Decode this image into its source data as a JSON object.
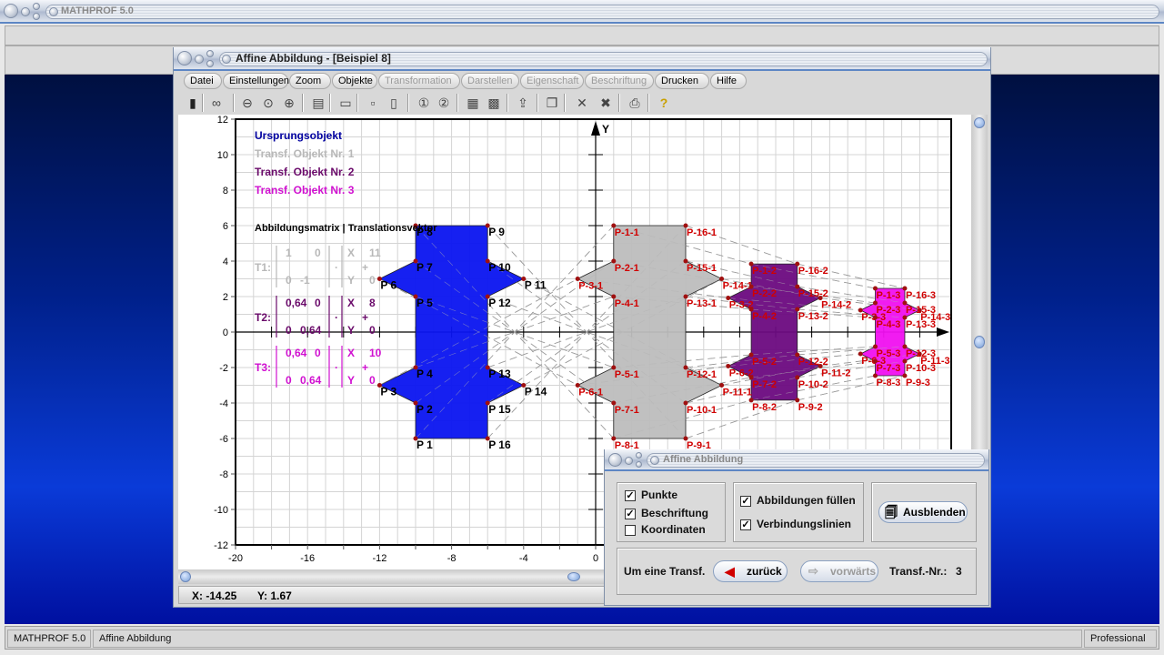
{
  "app": {
    "title": "MATHPROF 5.0"
  },
  "main_window": {
    "title": "Affine Abbildung - [Beispiel 8]",
    "menu": [
      {
        "label": "Datei",
        "enabled": true
      },
      {
        "label": "Einstellungen",
        "enabled": true
      },
      {
        "label": "Zoom",
        "enabled": true
      },
      {
        "label": "Objekte",
        "enabled": true
      },
      {
        "label": "Transformation",
        "enabled": false
      },
      {
        "label": "Darstellen",
        "enabled": false
      },
      {
        "label": "Eigenschaft",
        "enabled": false
      },
      {
        "label": "Beschriftung",
        "enabled": false
      },
      {
        "label": "Drucken",
        "enabled": true
      },
      {
        "label": "Hilfe",
        "enabled": true
      }
    ],
    "toolbar": [
      "window-icon",
      "glasses-icon",
      "zoom-out-icon",
      "zoom-reset-icon",
      "zoom-in-icon",
      "properties-icon",
      "panel-icon",
      "single-box-icon",
      "double-box-icon",
      "circle-1-icon",
      "circle-2-icon",
      "table-icon",
      "image-icon",
      "export-icon",
      "copy-icon",
      "clear-icon",
      "clear-all-icon",
      "print-icon",
      "help-icon"
    ],
    "coords": {
      "x": "X: -14.25",
      "y": "Y: 1.67"
    }
  },
  "chart_data": {
    "type": "scatter",
    "xlim": [
      -20,
      19.7
    ],
    "ylim": [
      -12,
      12
    ],
    "xticks": [
      -20,
      -16,
      -12,
      -8,
      -4,
      0
    ],
    "yticks": [
      12,
      10,
      8,
      6,
      4,
      2,
      0,
      -2,
      -4,
      -6,
      -8,
      -10,
      -12
    ],
    "ylabel": "Y",
    "grid": true,
    "legend": [
      {
        "label": "Ursprungsobjekt",
        "color": "#0000a0"
      },
      {
        "label": "Transf. Objekt Nr. 1",
        "color": "#b8b8b8"
      },
      {
        "label": "Transf. Objekt Nr. 2",
        "color": "#6a0a6a"
      },
      {
        "label": "Transf. Objekt Nr. 3",
        "color": "#d010d0"
      }
    ],
    "matrix_title": "Abbildungsmatrix | Translationsvektor",
    "transforms": [
      {
        "name": "T1:",
        "m": [
          "1",
          "0",
          "0",
          "-1"
        ],
        "t": [
          "11",
          "0"
        ],
        "color": "#b8b8b8"
      },
      {
        "name": "T2:",
        "m": [
          "0,64",
          "0",
          "0",
          "0,64"
        ],
        "t": [
          "8",
          "0"
        ],
        "color": "#6a0a6a"
      },
      {
        "name": "T3:",
        "m": [
          "0,64",
          "0",
          "0",
          "0,64"
        ],
        "t": [
          "10",
          "0"
        ],
        "color": "#d010d0"
      }
    ],
    "objects": [
      {
        "name": "Ursprungsobjekt",
        "fill": "#0a14f0",
        "label_color": "#000000",
        "label_fmt": "P {i}",
        "points": [
          [
            -10,
            -6
          ],
          [
            -10,
            -4
          ],
          [
            -12,
            -3
          ],
          [
            -10,
            -2
          ],
          [
            -10,
            2
          ],
          [
            -12,
            3
          ],
          [
            -10,
            4
          ],
          [
            -10,
            6
          ],
          [
            -6,
            6
          ],
          [
            -6,
            4
          ],
          [
            -4,
            3
          ],
          [
            -6,
            2
          ],
          [
            -6,
            -2
          ],
          [
            -4,
            -3
          ],
          [
            -6,
            -4
          ],
          [
            -6,
            -6
          ]
        ]
      },
      {
        "name": "Transf. Objekt Nr. 1",
        "fill": "#bdbdbd",
        "label_color": "#d00000",
        "label_fmt": "P-{i}-1",
        "points": [
          [
            1,
            6
          ],
          [
            1,
            4
          ],
          [
            -1,
            3
          ],
          [
            1,
            2
          ],
          [
            1,
            -2
          ],
          [
            -1,
            -3
          ],
          [
            1,
            -4
          ],
          [
            1,
            -6
          ],
          [
            5,
            -6
          ],
          [
            5,
            -4
          ],
          [
            7,
            -3
          ],
          [
            5,
            -2
          ],
          [
            5,
            2
          ],
          [
            7,
            3
          ],
          [
            5,
            4
          ],
          [
            5,
            6
          ]
        ]
      },
      {
        "name": "Transf. Objekt Nr. 2",
        "fill": "#6c0a80",
        "label_color": "#d00000",
        "label_fmt": "P-{i}-2",
        "points": [
          [
            8.64,
            3.84
          ],
          [
            8.64,
            2.56
          ],
          [
            7.36,
            1.92
          ],
          [
            8.64,
            1.28
          ],
          [
            8.64,
            -1.28
          ],
          [
            7.36,
            -1.92
          ],
          [
            8.64,
            -2.56
          ],
          [
            8.64,
            -3.84
          ],
          [
            11.2,
            -3.84
          ],
          [
            11.2,
            -2.56
          ],
          [
            12.48,
            -1.92
          ],
          [
            11.2,
            -1.28
          ],
          [
            11.2,
            1.28
          ],
          [
            12.48,
            1.92
          ],
          [
            11.2,
            2.56
          ],
          [
            11.2,
            3.84
          ]
        ]
      },
      {
        "name": "Transf. Objekt Nr. 3",
        "fill": "#f010f0",
        "label_color": "#d00000",
        "label_fmt": "P-{i}-3",
        "points": [
          [
            15.53,
            2.46
          ],
          [
            15.53,
            1.64
          ],
          [
            14.71,
            1.23
          ],
          [
            15.53,
            0.82
          ],
          [
            15.53,
            -0.82
          ],
          [
            14.71,
            -1.23
          ],
          [
            15.53,
            -1.64
          ],
          [
            15.53,
            -2.46
          ],
          [
            17.17,
            -2.46
          ],
          [
            17.17,
            -1.64
          ],
          [
            17.99,
            -1.23
          ],
          [
            17.17,
            -0.82
          ],
          [
            17.17,
            0.82
          ],
          [
            17.99,
            1.23
          ],
          [
            17.17,
            1.64
          ],
          [
            17.17,
            2.46
          ]
        ]
      }
    ]
  },
  "dialog": {
    "title": "Affine Abbildung",
    "checkboxes_left": [
      {
        "label": "Punkte",
        "checked": true
      },
      {
        "label": "Beschriftung",
        "checked": true
      },
      {
        "label": "Koordinaten",
        "checked": false
      }
    ],
    "checkboxes_mid": [
      {
        "label": "Abbildungen füllen",
        "checked": true
      },
      {
        "label": "Verbindungslinien",
        "checked": true
      }
    ],
    "hide_button": "Ausblenden",
    "step_label": "Um eine Transf.",
    "back_button": "zurück",
    "forward_button": "vorwärts",
    "transf_label": "Transf.-Nr.:",
    "transf_value": "3"
  },
  "statusbar": {
    "app": "MATHPROF 5.0",
    "module": "Affine Abbildung",
    "edition": "Professional"
  }
}
